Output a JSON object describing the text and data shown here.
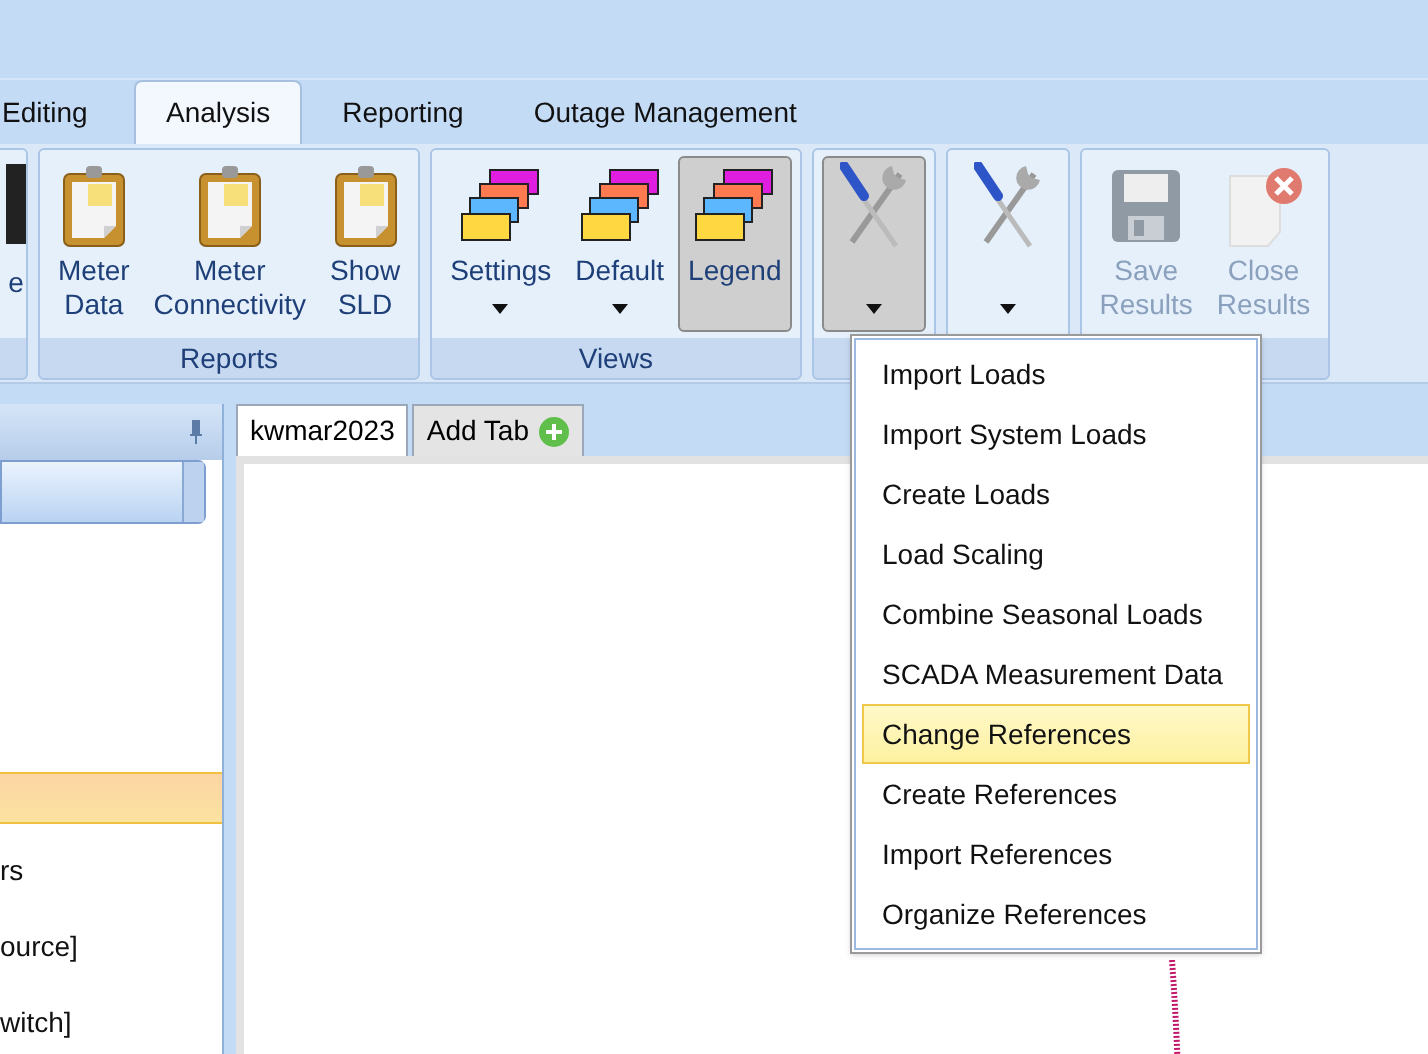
{
  "tabs": [
    {
      "label": "Editing",
      "selected": false
    },
    {
      "label": "Analysis",
      "selected": true
    },
    {
      "label": "Reporting",
      "selected": false
    },
    {
      "label": "Outage Management",
      "selected": false
    }
  ],
  "ribbon": {
    "groups": [
      {
        "buttons": [
          {
            "label": "e",
            "kind": "dark"
          }
        ]
      },
      {
        "label": "Reports",
        "buttons": [
          {
            "label": "Meter Data",
            "kind": "clipboard"
          },
          {
            "label": "Meter Connectivity",
            "kind": "clipboard"
          },
          {
            "label": "Show SLD",
            "kind": "clipboard"
          }
        ]
      },
      {
        "label": "Views",
        "buttons": [
          {
            "label": "Settings",
            "kind": "layers",
            "dropdown": true
          },
          {
            "label": "Default",
            "kind": "layers",
            "dropdown": true
          },
          {
            "label": "Legend",
            "kind": "layers",
            "pressed": true
          }
        ]
      },
      {
        "buttons": [
          {
            "kind": "tools",
            "dropdown": true,
            "pressed": true
          }
        ]
      },
      {
        "buttons": [
          {
            "kind": "tools",
            "dropdown": true
          }
        ]
      },
      {
        "buttons": [
          {
            "label": "Save Results",
            "kind": "save",
            "disabled": true
          },
          {
            "label": "Close Results",
            "kind": "close",
            "disabled": true
          }
        ]
      }
    ]
  },
  "side_panel": {
    "rows": [
      {
        "selected": true
      },
      {
        "text": "rs",
        "selected": false
      },
      {
        "text": "ource]",
        "selected": false
      },
      {
        "text": "witch]",
        "selected": false
      }
    ]
  },
  "document_tabs": [
    {
      "label": "kwmar2023",
      "kind": "tab",
      "selected": true
    },
    {
      "label": "Add Tab",
      "kind": "add",
      "selected": false
    }
  ],
  "menu": {
    "items": [
      {
        "label": "Import Loads",
        "selected": false
      },
      {
        "label": "Import System Loads",
        "selected": false
      },
      {
        "label": "Create Loads",
        "selected": false
      },
      {
        "label": "Load Scaling",
        "selected": false
      },
      {
        "label": "Combine Seasonal Loads",
        "selected": false
      },
      {
        "label": "SCADA Measurement Data",
        "selected": false
      },
      {
        "label": "Change References",
        "selected": true
      },
      {
        "label": "Create References",
        "selected": false
      },
      {
        "label": "Import References",
        "selected": false
      },
      {
        "label": "Organize References",
        "selected": false
      }
    ]
  }
}
